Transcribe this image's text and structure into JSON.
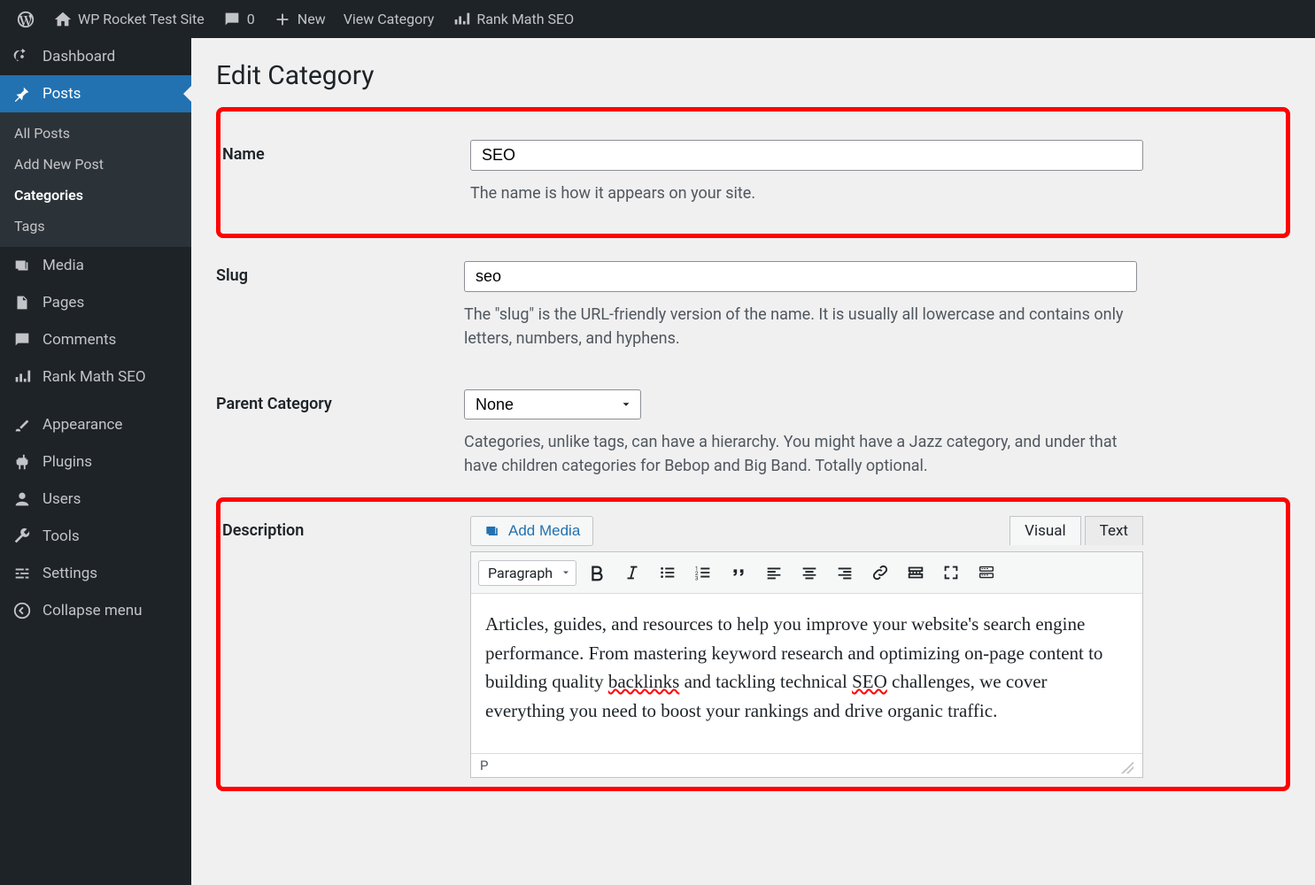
{
  "adminbar": {
    "site_name": "WP Rocket Test Site",
    "comments_count": "0",
    "new_label": "New",
    "view_category": "View Category",
    "rankmath": "Rank Math SEO"
  },
  "sidebar": {
    "dashboard": "Dashboard",
    "posts": "Posts",
    "posts_sub": {
      "all": "All Posts",
      "add": "Add New Post",
      "categories": "Categories",
      "tags": "Tags"
    },
    "media": "Media",
    "pages": "Pages",
    "comments": "Comments",
    "rankmath": "Rank Math SEO",
    "appearance": "Appearance",
    "plugins": "Plugins",
    "users": "Users",
    "tools": "Tools",
    "settings": "Settings",
    "collapse": "Collapse menu"
  },
  "page": {
    "title": "Edit Category",
    "name_label": "Name",
    "name_value": "SEO",
    "name_desc": "The name is how it appears on your site.",
    "slug_label": "Slug",
    "slug_value": "seo",
    "slug_desc": "The \"slug\" is the URL-friendly version of the name. It is usually all lowercase and contains only letters, numbers, and hyphens.",
    "parent_label": "Parent Category",
    "parent_value": "None",
    "parent_desc": "Categories, unlike tags, can have a hierarchy. You might have a Jazz category, and under that have children categories for Bebop and Big Band. Totally optional.",
    "desc_label": "Description"
  },
  "editor": {
    "add_media": "Add Media",
    "tab_visual": "Visual",
    "tab_text": "Text",
    "format": "Paragraph",
    "content_a": "Articles, guides, and resources to help you improve your website's search engine performance. From mastering keyword research and optimizing on-page content to building quality ",
    "content_b": "backlinks",
    "content_c": " and tackling technical ",
    "content_d": "SEO",
    "content_e": " challenges, we cover everything you need to boost your rankings and drive organic traffic.",
    "status_path": "P"
  }
}
